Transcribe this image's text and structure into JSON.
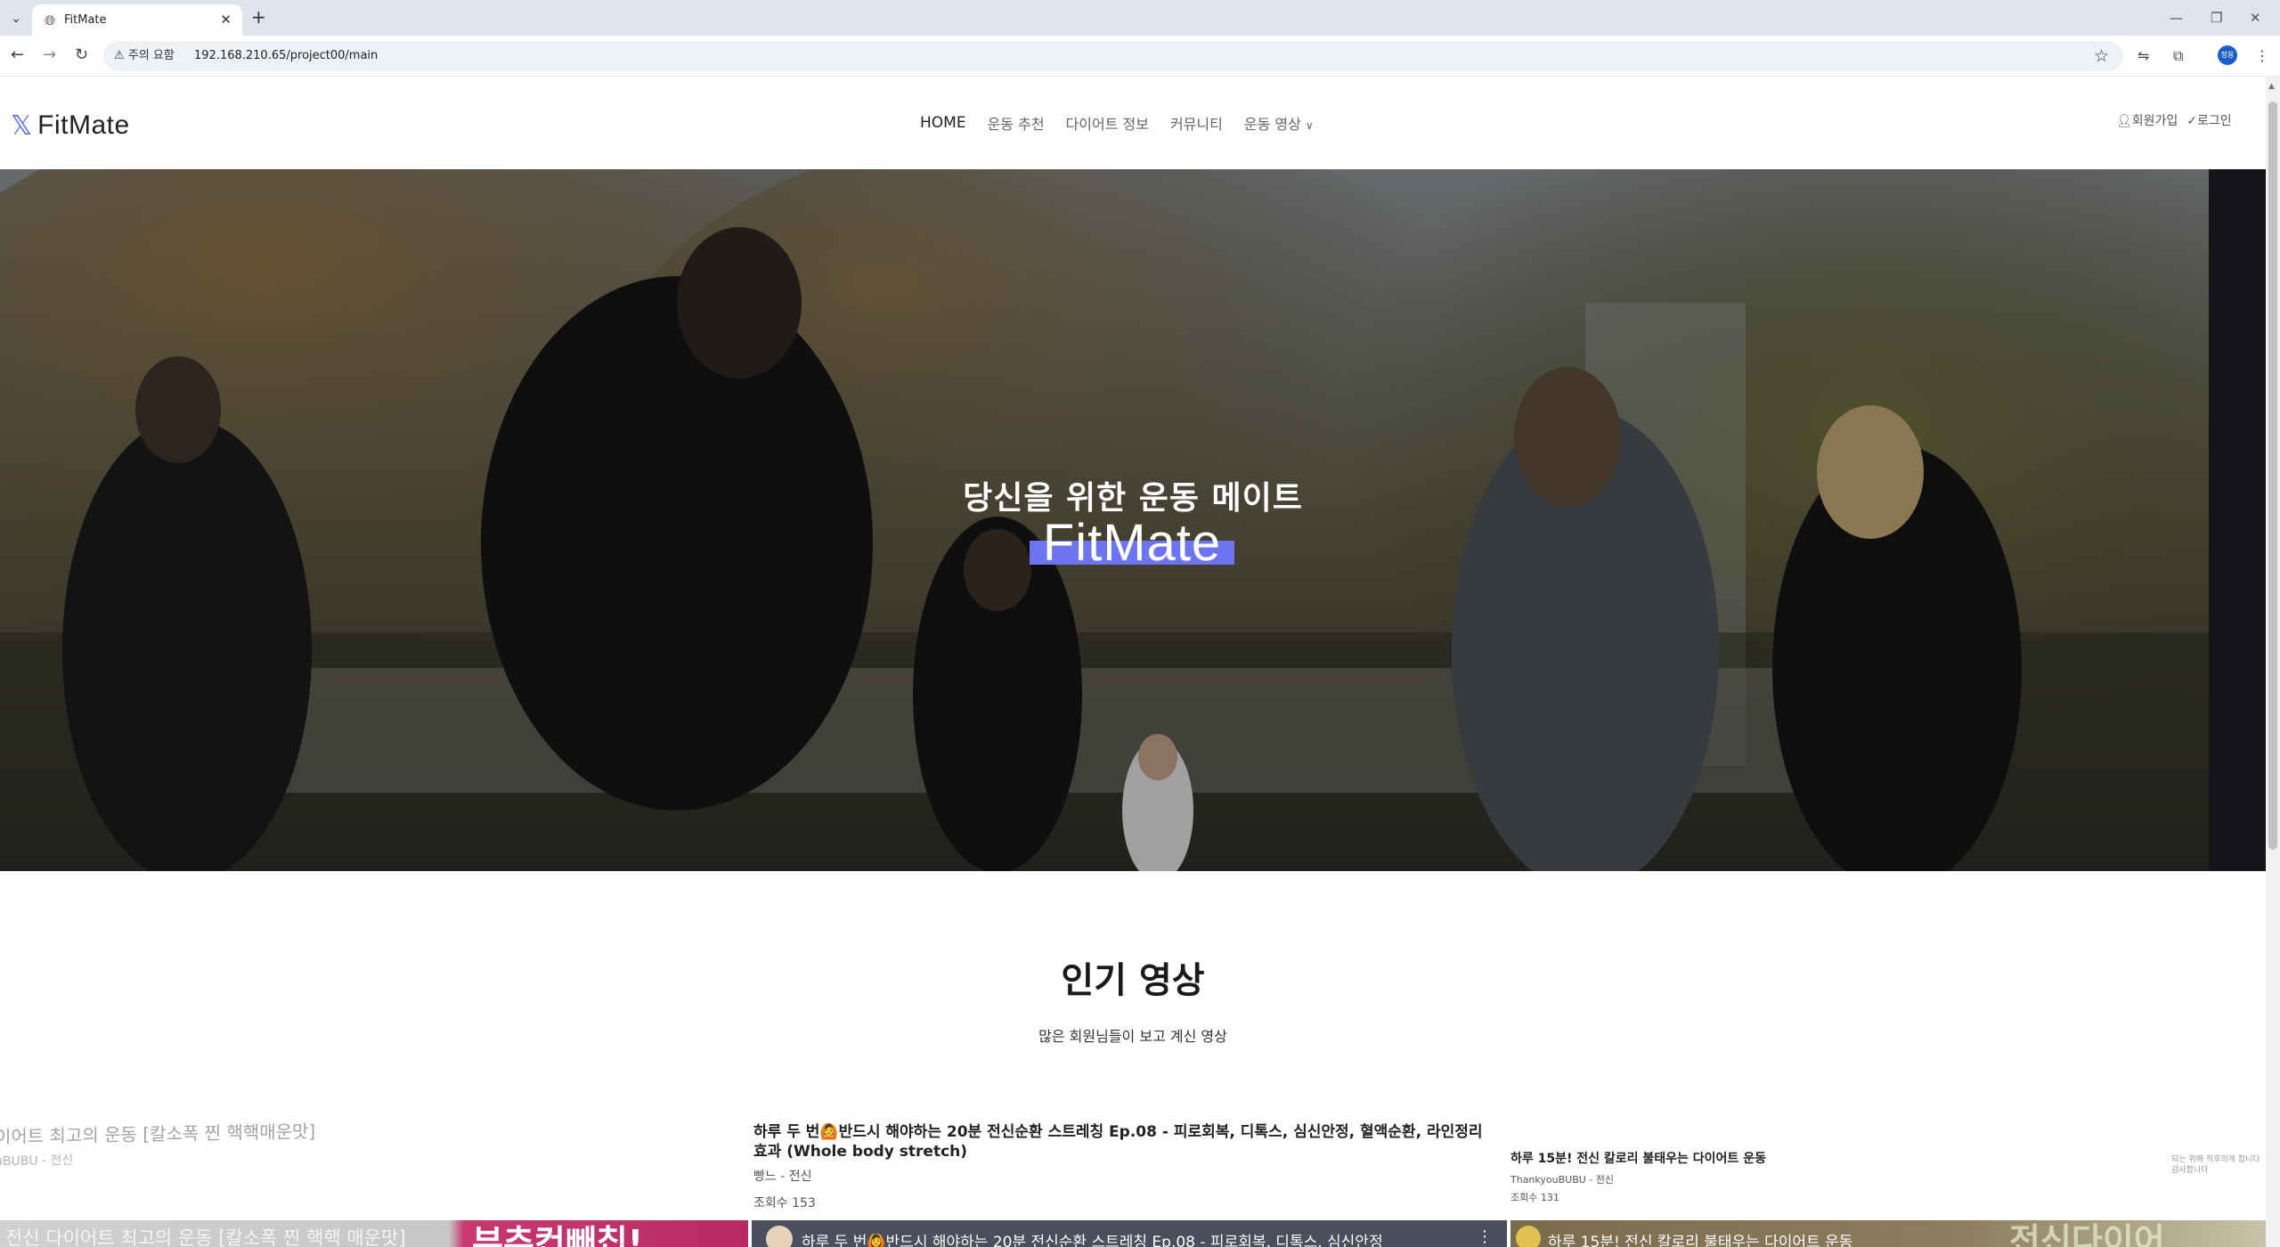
{
  "browser": {
    "tab_title": "FitMate",
    "security_label": "주의 요함",
    "url": "192.168.210.65/project00/main",
    "profile_initials": "정용"
  },
  "site": {
    "logo_text": "FitMate",
    "nav": [
      "HOME",
      "운동 추천",
      "다이어트 정보",
      "커뮤니티",
      "운동 영상"
    ],
    "signup": "회원가입",
    "login": "로그인",
    "accent_color": "#6c74ee"
  },
  "hero": {
    "subtitle": "당신을 위한 운동 메이트",
    "title": "FitMate"
  },
  "popular": {
    "heading": "인기 영상",
    "description": "많은 회원님들이 보고 계신 영상",
    "videos": [
      {
        "title": "이어트 최고의 운동 [칼소폭 찐 핵핵매운맛]",
        "channel": "uBUBU - 전신",
        "thumb_title": "전신 다이어트 최고의 운동 [칼소폭 찐 핵핵 매운맛]",
        "thumb_big": "부추컨빼칩!"
      },
      {
        "title": "하루 두 번🙆반드시 해야하는 20분 전신순환 스트레칭 Ep.08 - 피로회복, 디톡스, 심신안정, 혈액순환, 라인정리 효과 (Whole body stretch)",
        "channel": "빵느 - 전신",
        "views": "조회수 153",
        "thumb_title": "하루 두 번🙆반드시 해야하는 20분 전신순환 스트레칭 Ep.08 - 피로회복, 디톡스, 심신안정"
      },
      {
        "title": "하루 15분! 전신 칼로리 불태우는 다이어트 운동",
        "channel": "ThankyouBUBU - 전신",
        "views": "조회수 131",
        "thumb_title": "하루 15분! 전신 칼로리 불태우는 다이어트 운동",
        "thumb_big": "전신다이어"
      }
    ],
    "corner_note": "되는 위해 적후의게 합니다 감사합니다"
  }
}
